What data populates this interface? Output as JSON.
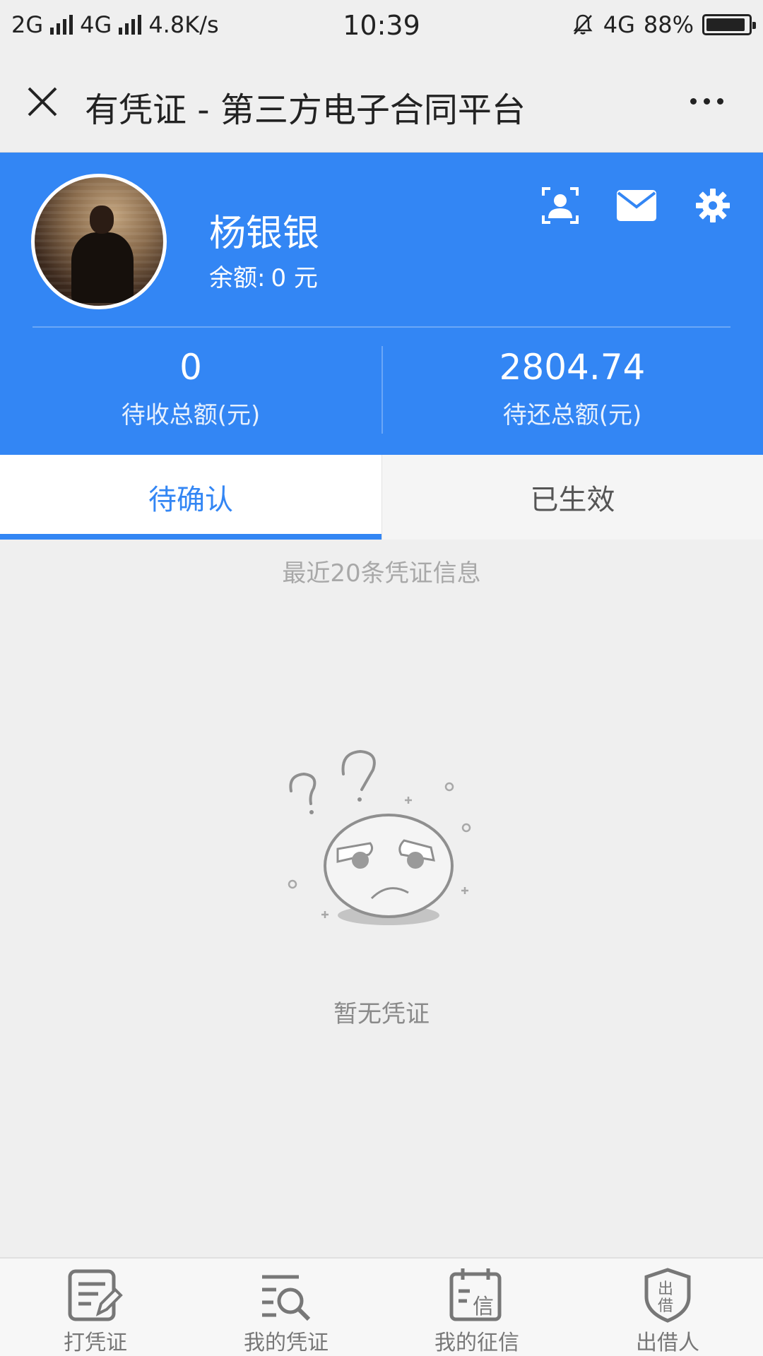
{
  "status_bar": {
    "network_left": "2G",
    "network_mid": "4G",
    "speed": "4.8K/s",
    "time": "10:39",
    "network_right": "4G",
    "battery": "88%"
  },
  "title_bar": {
    "title": "有凭证 - 第三方电子合同平台"
  },
  "profile": {
    "name": "杨银银",
    "balance_label": "余额:",
    "balance_value": "0 元",
    "icons": [
      "contact-card-icon",
      "envelope-icon",
      "gear-icon"
    ]
  },
  "stats": {
    "receivable_value": "0",
    "receivable_label": "待收总额(元)",
    "payable_value": "2804.74",
    "payable_label": "待还总额(元)"
  },
  "tabs": [
    {
      "label": "待确认",
      "active": true
    },
    {
      "label": "已生效",
      "active": false
    }
  ],
  "list": {
    "note": "最近20条凭证信息",
    "empty_text": "暂无凭证"
  },
  "bottom_nav": [
    {
      "label": "打凭证",
      "icon": "write-document-icon"
    },
    {
      "label": "我的凭证",
      "icon": "search-list-icon"
    },
    {
      "label": "我的征信",
      "icon": "credit-calendar-icon"
    },
    {
      "label": "出借人",
      "icon": "lender-shield-icon"
    }
  ],
  "colors": {
    "brand": "#3386f4",
    "background": "#efefef"
  }
}
